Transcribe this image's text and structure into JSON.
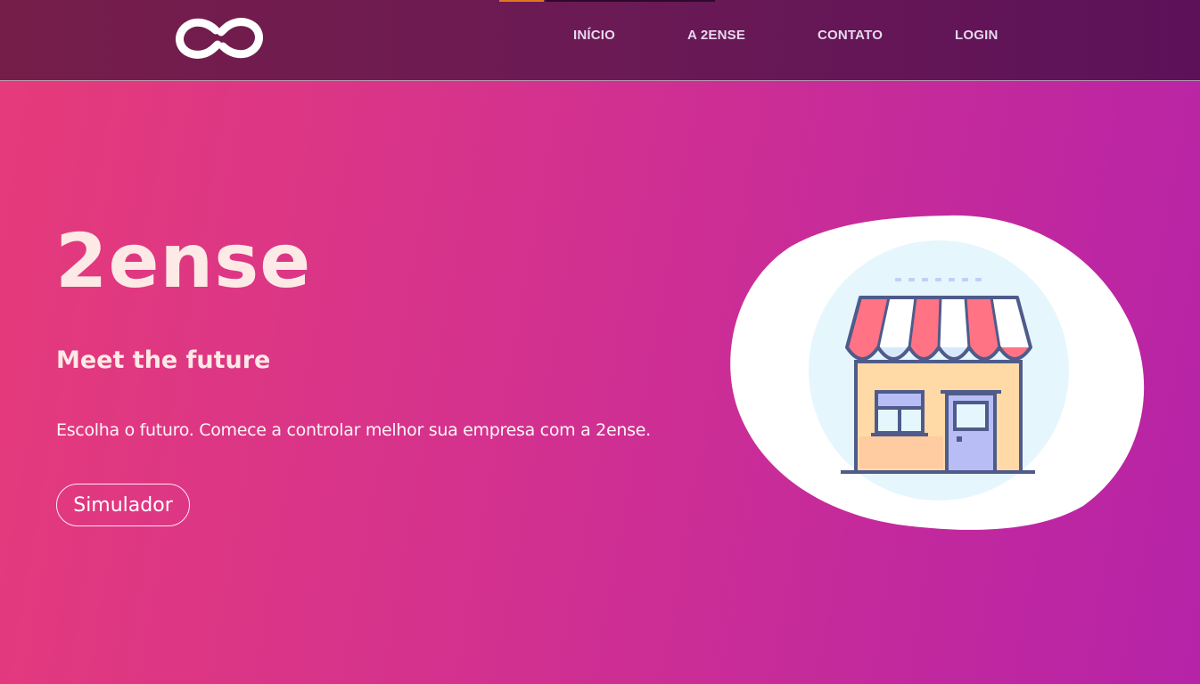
{
  "navbar": {
    "logo_name": "infinity-link-logo",
    "links": [
      {
        "label": "INÍCIO"
      },
      {
        "label": "A 2ENSE"
      },
      {
        "label": "CONTATO"
      },
      {
        "label": "LOGIN"
      }
    ]
  },
  "hero": {
    "title": "2ense",
    "tagline": "Meet the future",
    "description": "Escolha o futuro. Comece a controlar melhor sua empresa com a 2ense.",
    "cta_label": "Simulador",
    "illustration": "storefront-icon"
  },
  "colors": {
    "gradient_start": "#e63b7a",
    "gradient_end": "#b623a8",
    "navbar_bg": "#6b1a54",
    "text_light": "#fde9e5",
    "awning_red": "#ff7385",
    "shop_wall": "#ffdaa6",
    "door": "#b9bdf5",
    "outline": "#4f5b8a"
  }
}
